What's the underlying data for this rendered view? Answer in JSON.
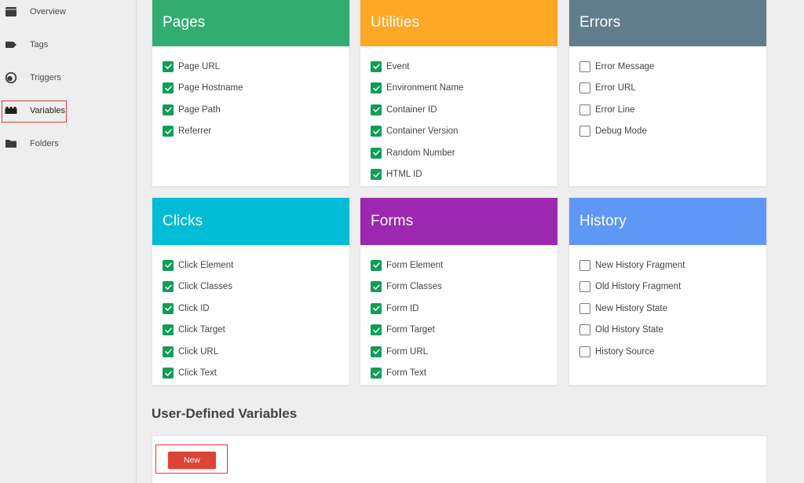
{
  "sidebar": {
    "items": [
      {
        "label": "Overview",
        "icon": "overview-icon"
      },
      {
        "label": "Tags",
        "icon": "tag-icon"
      },
      {
        "label": "Triggers",
        "icon": "trigger-icon"
      },
      {
        "label": "Variables",
        "icon": "variables-icon",
        "active": true
      },
      {
        "label": "Folders",
        "icon": "folder-icon"
      }
    ]
  },
  "colors": {
    "pages": "#33ac71",
    "utilities": "#ffa726",
    "errors": "#607d8b",
    "clicks": "#00bcd4",
    "forms": "#9c27b0",
    "history": "#5e97f6",
    "checked": "#0f9d58",
    "new_button": "#db4437",
    "highlight": "#e53935"
  },
  "cards": {
    "pages": {
      "title": "Pages",
      "items": [
        {
          "label": "Page URL",
          "checked": true
        },
        {
          "label": "Page Hostname",
          "checked": true
        },
        {
          "label": "Page Path",
          "checked": true
        },
        {
          "label": "Referrer",
          "checked": true
        }
      ]
    },
    "utilities": {
      "title": "Utilities",
      "items": [
        {
          "label": "Event",
          "checked": true
        },
        {
          "label": "Environment Name",
          "checked": true
        },
        {
          "label": "Container ID",
          "checked": true
        },
        {
          "label": "Container Version",
          "checked": true
        },
        {
          "label": "Random Number",
          "checked": true
        },
        {
          "label": "HTML ID",
          "checked": true
        }
      ]
    },
    "errors": {
      "title": "Errors",
      "items": [
        {
          "label": "Error Message",
          "checked": false
        },
        {
          "label": "Error URL",
          "checked": false
        },
        {
          "label": "Error Line",
          "checked": false
        },
        {
          "label": "Debug Mode",
          "checked": false
        }
      ]
    },
    "clicks": {
      "title": "Clicks",
      "items": [
        {
          "label": "Click Element",
          "checked": true
        },
        {
          "label": "Click Classes",
          "checked": true
        },
        {
          "label": "Click ID",
          "checked": true
        },
        {
          "label": "Click Target",
          "checked": true
        },
        {
          "label": "Click URL",
          "checked": true
        },
        {
          "label": "Click Text",
          "checked": true
        }
      ]
    },
    "forms": {
      "title": "Forms",
      "items": [
        {
          "label": "Form Element",
          "checked": true
        },
        {
          "label": "Form Classes",
          "checked": true
        },
        {
          "label": "Form ID",
          "checked": true
        },
        {
          "label": "Form Target",
          "checked": true
        },
        {
          "label": "Form URL",
          "checked": true
        },
        {
          "label": "Form Text",
          "checked": true
        }
      ]
    },
    "history": {
      "title": "History",
      "items": [
        {
          "label": "New History Fragment",
          "checked": false
        },
        {
          "label": "Old History Fragment",
          "checked": false
        },
        {
          "label": "New History State",
          "checked": false
        },
        {
          "label": "Old History State",
          "checked": false
        },
        {
          "label": "History Source",
          "checked": false
        }
      ]
    }
  },
  "user_defined": {
    "title": "User-Defined Variables",
    "new_label": "New"
  }
}
